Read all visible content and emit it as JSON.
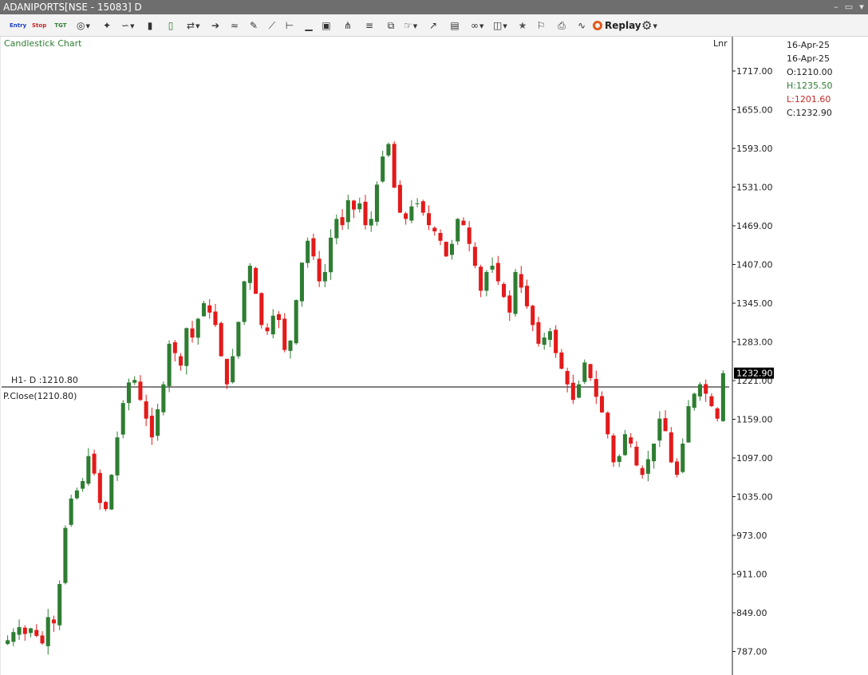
{
  "window": {
    "title": "ADANIPORTS[NSE - 15083] D"
  },
  "toolbar": {
    "entry_label": "Entry",
    "stop_label": "Stop",
    "tgt_label": "TGT",
    "replay_label": "Replay"
  },
  "chart_panel": {
    "title": "Candlestick Chart",
    "scale_mode": "Lnr",
    "last_price_tag": "1232.90"
  },
  "info_panel": {
    "date_1": "16-Apr-25",
    "date_2": "16-Apr-25",
    "open": "O:1210.00",
    "high": "H:1235.50",
    "low": "L:1201.60",
    "close": "C:1232.90"
  },
  "reference_lines": {
    "h1_label": "H1- D :1210.80",
    "pclose_label": "P.Close(1210.80)"
  },
  "colors": {
    "up": "#2e7d32",
    "down": "#e31a1a",
    "axis": "#222222",
    "price_tag_bg": "#000000"
  },
  "chart_data": {
    "type": "candlestick",
    "title": "Candlestick Chart",
    "symbol": "ADANIPORTS",
    "interval": "D",
    "y_axis": {
      "ticks": [
        "1717.00",
        "1655.00",
        "1593.00",
        "1531.00",
        "1469.00",
        "1407.00",
        "1345.00",
        "1283.00",
        "1221.00",
        "1159.00",
        "1097.00",
        "1035.00",
        "973.00",
        "911.00",
        "849.00",
        "787.00"
      ],
      "range": [
        770,
        1745
      ],
      "scale": "linear"
    },
    "reference_line": {
      "name": "H1- D",
      "value": 1210.8
    },
    "previous_close": 1210.8,
    "last_close": 1232.9,
    "close_series": [
      805,
      818,
      826,
      815,
      824,
      812,
      800,
      842,
      832,
      895,
      985,
      1032,
      1045,
      1060,
      1100,
      1072,
      1025,
      1015,
      1070,
      1130,
      1185,
      1218,
      1222,
      1190,
      1160,
      1130,
      1175,
      1215,
      1280,
      1265,
      1245,
      1305,
      1290,
      1320,
      1345,
      1330,
      1310,
      1260,
      1215,
      1260,
      1315,
      1380,
      1405,
      1360,
      1310,
      1300,
      1325,
      1318,
      1270,
      1285,
      1350,
      1410,
      1445,
      1420,
      1380,
      1395,
      1450,
      1480,
      1470,
      1510,
      1495,
      1505,
      1470,
      1480,
      1535,
      1580,
      1600,
      1530,
      1490,
      1480,
      1500,
      1505,
      1490,
      1470,
      1460,
      1445,
      1420,
      1440,
      1480,
      1470,
      1440,
      1405,
      1365,
      1395,
      1405,
      1380,
      1355,
      1330,
      1395,
      1370,
      1340,
      1310,
      1280,
      1290,
      1300,
      1265,
      1240,
      1215,
      1190,
      1215,
      1250,
      1225,
      1195,
      1170,
      1135,
      1090,
      1100,
      1135,
      1120,
      1085,
      1070,
      1095,
      1120,
      1160,
      1140,
      1090,
      1070,
      1120,
      1180,
      1200,
      1215,
      1200,
      1180,
      1160,
      1232.9
    ]
  }
}
